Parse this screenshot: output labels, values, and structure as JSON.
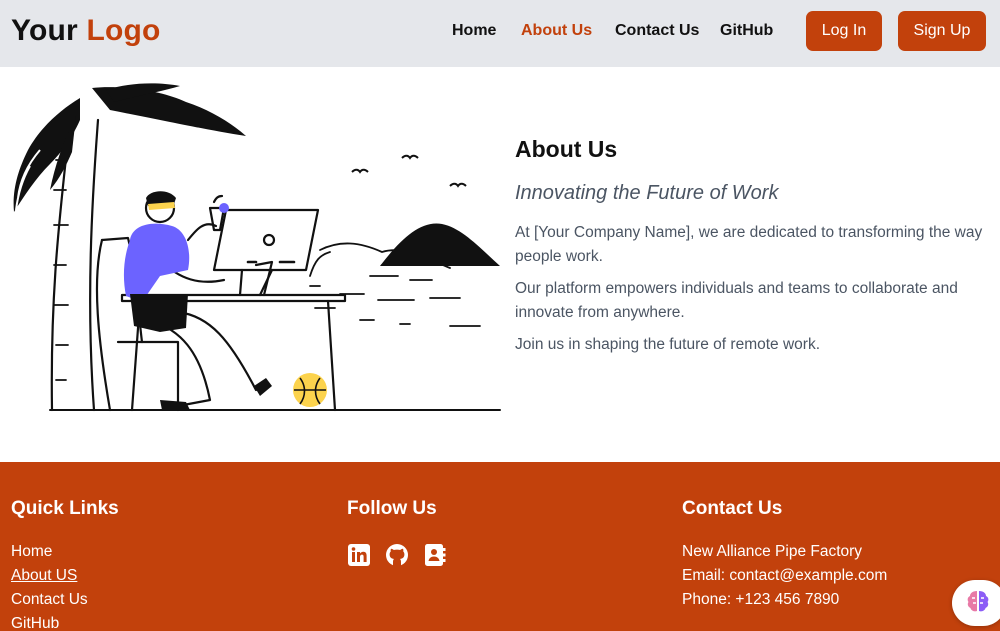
{
  "header": {
    "logo_part1": "Your",
    "logo_part2": "Logo",
    "nav": [
      "Home",
      "About Us",
      "Contact Us",
      "GitHub"
    ],
    "active_nav": "About Us",
    "login_label": "Log In",
    "signup_label": "Sign Up"
  },
  "about": {
    "title": "About Us",
    "subtitle": "Innovating the Future of Work",
    "p1": "At [Your Company Name], we are dedicated to transforming the way people work.",
    "p2": "Our platform empowers individuals and teams to collaborate and innovate from anywhere.",
    "p3": "Join us in shaping the future of remote work."
  },
  "footer": {
    "quick_links_title": "Quick Links",
    "quick_links": [
      "Home",
      "About US",
      "Contact Us",
      "GitHub"
    ],
    "follow_title": "Follow Us",
    "social_icons": [
      "linkedin-icon",
      "github-icon",
      "contact-card-icon"
    ],
    "contact_title": "Contact Us",
    "contact_lines": [
      "New Alliance Pipe Factory",
      "Email: contact@example.com",
      "Phone: +123 456 7890"
    ]
  },
  "colors": {
    "brand": "#c2410c",
    "header_bg": "#e5e7eb",
    "text_muted": "#4b5563",
    "accent_purple": "#6c63ff",
    "accent_yellow": "#fcd34d"
  }
}
